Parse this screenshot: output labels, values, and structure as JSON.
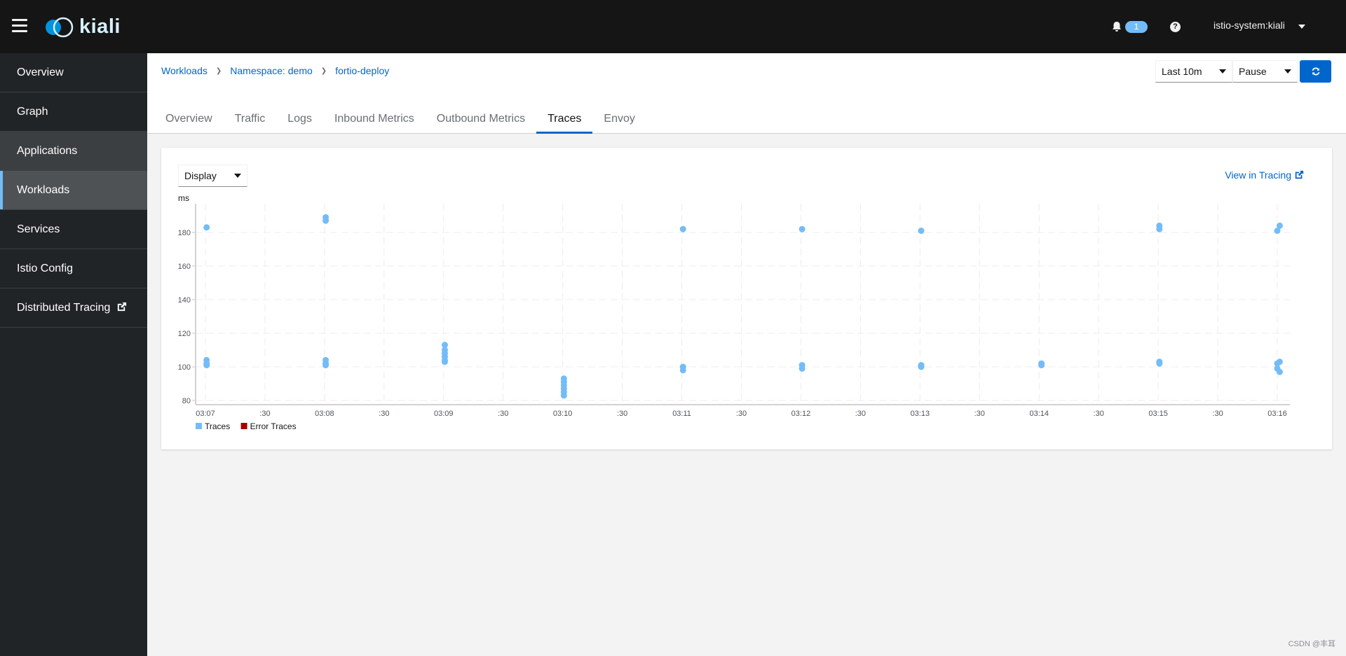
{
  "masthead": {
    "logo_text": "kiali",
    "notification_count": "1",
    "help_symbol": "?",
    "user": "istio-system:kiali"
  },
  "sidebar": {
    "items": [
      {
        "label": "Overview",
        "state": "normal"
      },
      {
        "label": "Graph",
        "state": "normal"
      },
      {
        "label": "Applications",
        "state": "hover"
      },
      {
        "label": "Workloads",
        "state": "active"
      },
      {
        "label": "Services",
        "state": "normal"
      },
      {
        "label": "Istio Config",
        "state": "normal"
      },
      {
        "label": "Distributed Tracing",
        "state": "normal",
        "external": true
      }
    ]
  },
  "breadcrumb": [
    {
      "label": "Workloads"
    },
    {
      "label": "Namespace: demo"
    },
    {
      "label": "fortio-deploy"
    }
  ],
  "controls": {
    "time_range": "Last 10m",
    "refresh_interval": "Pause",
    "refresh_icon": "sync-icon"
  },
  "tabs": [
    {
      "label": "Overview",
      "active": false
    },
    {
      "label": "Traffic",
      "active": false
    },
    {
      "label": "Logs",
      "active": false
    },
    {
      "label": "Inbound Metrics",
      "active": false
    },
    {
      "label": "Outbound Metrics",
      "active": false
    },
    {
      "label": "Traces",
      "active": true
    },
    {
      "label": "Envoy",
      "active": false
    }
  ],
  "traces_panel": {
    "display_select": "Display",
    "view_in_tracing": "View in Tracing"
  },
  "colors": {
    "accent": "#0066cc",
    "trace_point": "#73bcf7",
    "error_trace": "#a30000",
    "masthead_bg": "#151515",
    "sidebar_bg": "#212427"
  },
  "chart_data": {
    "type": "scatter",
    "title": "",
    "xlabel": "",
    "ylabel": "ms",
    "x_unit": "minutes after 03:07",
    "xlim": [
      0,
      9.1
    ],
    "ylim": [
      78,
      190
    ],
    "grid": true,
    "y_ticks": [
      80,
      100,
      120,
      140,
      160,
      180
    ],
    "x_ticks": [
      {
        "value": 0,
        "label": "03:07"
      },
      {
        "value": 0.5,
        "label": ":30"
      },
      {
        "value": 1,
        "label": "03:08"
      },
      {
        "value": 1.5,
        "label": ":30"
      },
      {
        "value": 2,
        "label": "03:09"
      },
      {
        "value": 2.5,
        "label": ":30"
      },
      {
        "value": 3,
        "label": "03:10"
      },
      {
        "value": 3.5,
        "label": ":30"
      },
      {
        "value": 4,
        "label": "03:11"
      },
      {
        "value": 4.5,
        "label": ":30"
      },
      {
        "value": 5,
        "label": "03:12"
      },
      {
        "value": 5.5,
        "label": ":30"
      },
      {
        "value": 6,
        "label": "03:13"
      },
      {
        "value": 6.5,
        "label": ":30"
      },
      {
        "value": 7,
        "label": "03:14"
      },
      {
        "value": 7.5,
        "label": ":30"
      },
      {
        "value": 8,
        "label": "03:15"
      },
      {
        "value": 8.5,
        "label": ":30"
      },
      {
        "value": 9,
        "label": "03:16"
      }
    ],
    "legend_position": "bottom-left",
    "series": [
      {
        "name": "Traces",
        "color": "#73bcf7",
        "points": [
          {
            "x": 0.01,
            "y": 183
          },
          {
            "x": 0.01,
            "y": 104
          },
          {
            "x": 0.01,
            "y": 102
          },
          {
            "x": 0.01,
            "y": 101
          },
          {
            "x": 1.01,
            "y": 189
          },
          {
            "x": 1.01,
            "y": 187
          },
          {
            "x": 1.01,
            "y": 104
          },
          {
            "x": 1.01,
            "y": 102
          },
          {
            "x": 1.01,
            "y": 101
          },
          {
            "x": 2.01,
            "y": 113
          },
          {
            "x": 2.01,
            "y": 110
          },
          {
            "x": 2.01,
            "y": 108
          },
          {
            "x": 2.01,
            "y": 106
          },
          {
            "x": 2.01,
            "y": 104
          },
          {
            "x": 2.01,
            "y": 103
          },
          {
            "x": 3.01,
            "y": 93
          },
          {
            "x": 3.01,
            "y": 91
          },
          {
            "x": 3.01,
            "y": 89
          },
          {
            "x": 3.01,
            "y": 87
          },
          {
            "x": 3.01,
            "y": 85
          },
          {
            "x": 3.01,
            "y": 83
          },
          {
            "x": 4.01,
            "y": 182
          },
          {
            "x": 4.01,
            "y": 100
          },
          {
            "x": 4.01,
            "y": 98
          },
          {
            "x": 5.01,
            "y": 182
          },
          {
            "x": 5.01,
            "y": 101
          },
          {
            "x": 5.01,
            "y": 99
          },
          {
            "x": 6.01,
            "y": 181
          },
          {
            "x": 6.01,
            "y": 101
          },
          {
            "x": 6.01,
            "y": 100
          },
          {
            "x": 7.02,
            "y": 102
          },
          {
            "x": 7.02,
            "y": 101
          },
          {
            "x": 8.01,
            "y": 184
          },
          {
            "x": 8.01,
            "y": 182
          },
          {
            "x": 8.01,
            "y": 103
          },
          {
            "x": 8.01,
            "y": 102
          },
          {
            "x": 9.0,
            "y": 181
          },
          {
            "x": 9.02,
            "y": 184
          },
          {
            "x": 9.0,
            "y": 102
          },
          {
            "x": 9.0,
            "y": 99
          },
          {
            "x": 9.02,
            "y": 103
          },
          {
            "x": 9.02,
            "y": 97
          }
        ]
      },
      {
        "name": "Error Traces",
        "color": "#a30000",
        "points": []
      }
    ]
  },
  "watermark": "CSDN @丰耳"
}
